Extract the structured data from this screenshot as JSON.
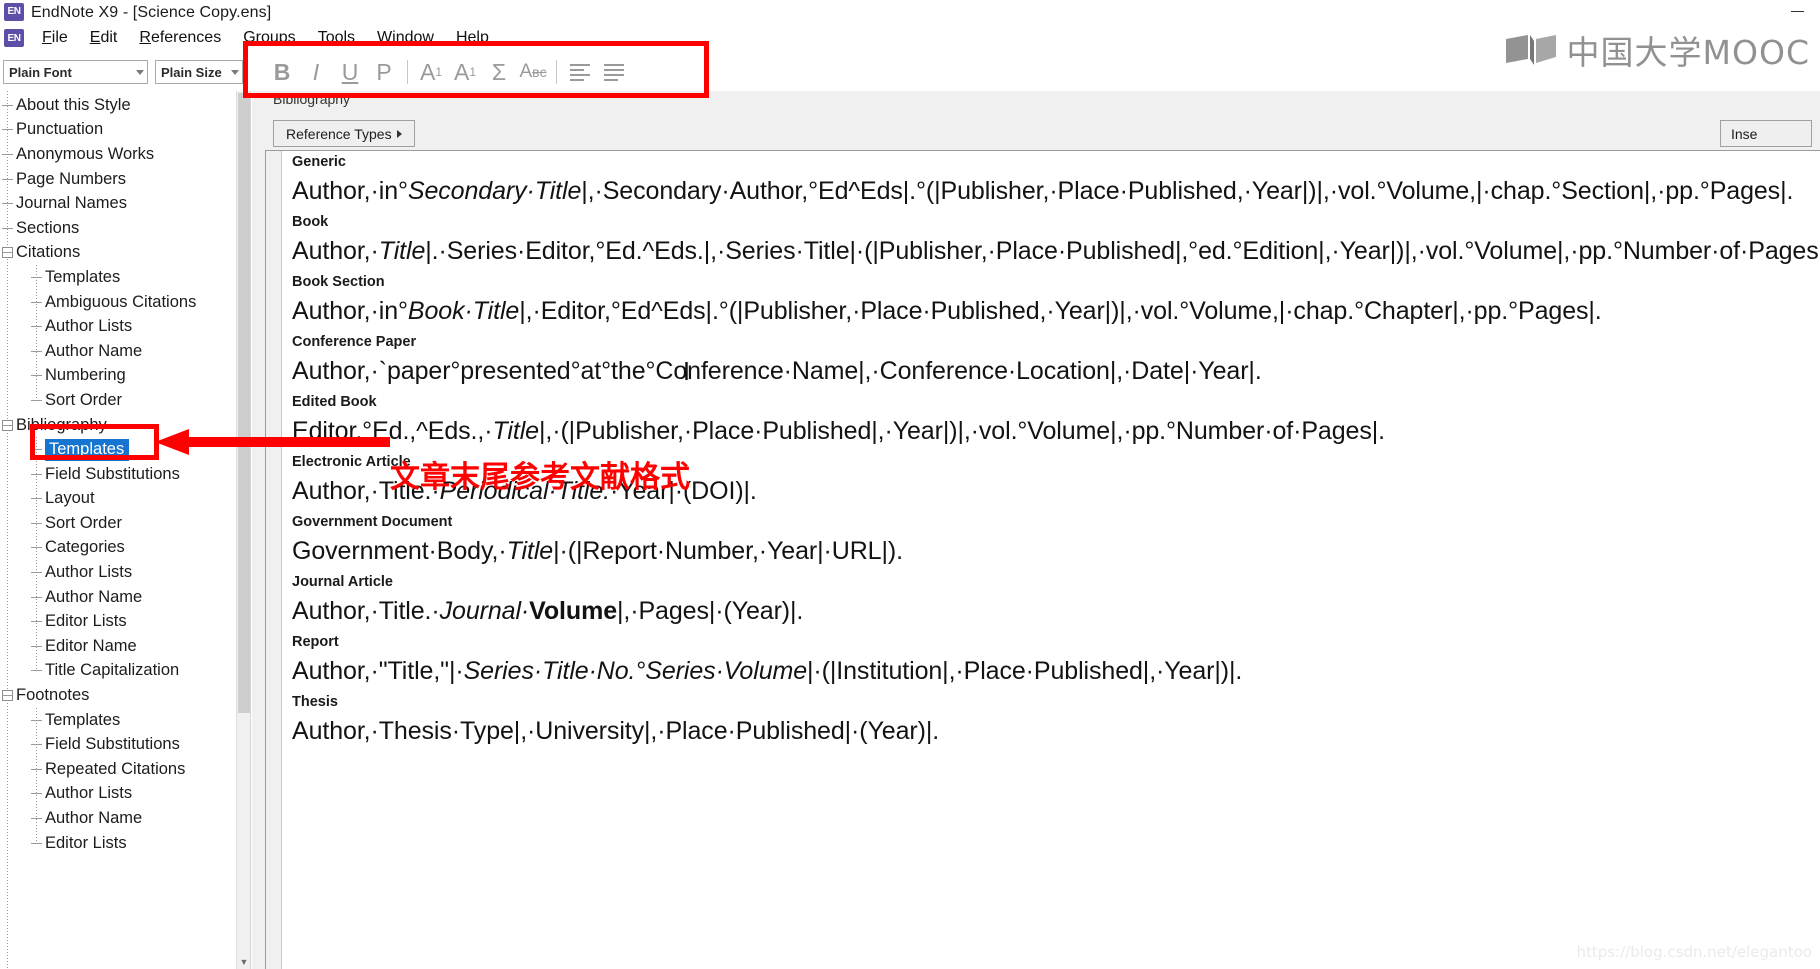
{
  "window": {
    "title": "EndNote X9 - [Science Copy.ens]",
    "app_icon": "endnote-icon",
    "minimize_label": "Minimize"
  },
  "menubar": {
    "app_icon": "endnote-icon",
    "items": [
      {
        "label": "File"
      },
      {
        "label": "Edit"
      },
      {
        "label": "References"
      },
      {
        "label": "Groups"
      },
      {
        "label": "Tools"
      },
      {
        "label": "Window"
      },
      {
        "label": "Help"
      }
    ]
  },
  "format_toolbar": {
    "font_combo": {
      "value": "Plain Font",
      "icon": "chevron-down-icon"
    },
    "size_combo": {
      "value": "Plain Size",
      "icon": "chevron-down-icon"
    },
    "buttons": [
      {
        "name": "bold-button",
        "glyph": "B"
      },
      {
        "name": "italic-button",
        "glyph": "I"
      },
      {
        "name": "underline-button",
        "glyph": "U"
      },
      {
        "name": "plain-button",
        "glyph": "P"
      },
      {
        "name": "superscript-button",
        "glyph": "A¹"
      },
      {
        "name": "subscript-button",
        "glyph": "A₁"
      },
      {
        "name": "symbol-button",
        "glyph": "Σ"
      },
      {
        "name": "strikethrough-button",
        "glyph": "Aʙс"
      },
      {
        "name": "align-left-button",
        "glyph": "≡"
      },
      {
        "name": "align-justify-button",
        "glyph": "≡"
      }
    ]
  },
  "brand_watermark": {
    "text": "中国大学MOOC",
    "icon": "open-book-icon"
  },
  "tree": {
    "items": [
      {
        "label": "About this Style",
        "level": 1,
        "expander": null,
        "selected": false
      },
      {
        "label": "Punctuation",
        "level": 1,
        "expander": null,
        "selected": false
      },
      {
        "label": "Anonymous Works",
        "level": 1,
        "expander": null,
        "selected": false
      },
      {
        "label": "Page Numbers",
        "level": 1,
        "expander": null,
        "selected": false
      },
      {
        "label": "Journal Names",
        "level": 1,
        "expander": null,
        "selected": false
      },
      {
        "label": "Sections",
        "level": 1,
        "expander": null,
        "selected": false
      },
      {
        "label": "Citations",
        "level": 1,
        "expander": "collapse",
        "selected": false
      },
      {
        "label": "Templates",
        "level": 2,
        "expander": null,
        "selected": false
      },
      {
        "label": "Ambiguous Citations",
        "level": 2,
        "expander": null,
        "selected": false
      },
      {
        "label": "Author Lists",
        "level": 2,
        "expander": null,
        "selected": false
      },
      {
        "label": "Author Name",
        "level": 2,
        "expander": null,
        "selected": false
      },
      {
        "label": "Numbering",
        "level": 2,
        "expander": null,
        "selected": false
      },
      {
        "label": "Sort Order",
        "level": 2,
        "expander": null,
        "selected": false
      },
      {
        "label": "Bibliography",
        "level": 1,
        "expander": "collapse",
        "selected": false
      },
      {
        "label": "Templates",
        "level": 2,
        "expander": null,
        "selected": true
      },
      {
        "label": "Field Substitutions",
        "level": 2,
        "expander": null,
        "selected": false
      },
      {
        "label": "Layout",
        "level": 2,
        "expander": null,
        "selected": false
      },
      {
        "label": "Sort Order",
        "level": 2,
        "expander": null,
        "selected": false
      },
      {
        "label": "Categories",
        "level": 2,
        "expander": null,
        "selected": false
      },
      {
        "label": "Author Lists",
        "level": 2,
        "expander": null,
        "selected": false
      },
      {
        "label": "Author Name",
        "level": 2,
        "expander": null,
        "selected": false
      },
      {
        "label": "Editor Lists",
        "level": 2,
        "expander": null,
        "selected": false
      },
      {
        "label": "Editor Name",
        "level": 2,
        "expander": null,
        "selected": false
      },
      {
        "label": "Title Capitalization",
        "level": 2,
        "expander": null,
        "selected": false
      },
      {
        "label": "Footnotes",
        "level": 1,
        "expander": "collapse",
        "selected": false
      },
      {
        "label": "Templates",
        "level": 2,
        "expander": null,
        "selected": false
      },
      {
        "label": "Field Substitutions",
        "level": 2,
        "expander": null,
        "selected": false
      },
      {
        "label": "Repeated Citations",
        "level": 2,
        "expander": null,
        "selected": false
      },
      {
        "label": "Author Lists",
        "level": 2,
        "expander": null,
        "selected": false
      },
      {
        "label": "Author Name",
        "level": 2,
        "expander": null,
        "selected": false
      },
      {
        "label": "Editor Lists",
        "level": 2,
        "expander": null,
        "selected": false
      }
    ],
    "scrollbar": {
      "up_arrow": "▲",
      "down_arrow": "▼"
    }
  },
  "editor": {
    "caption": "Bibliography",
    "reference_types_button": "Reference Types",
    "insert_field_button": "Inse",
    "templates": [
      {
        "name": "Generic",
        "segments": [
          {
            "t": "Author,·in°",
            "s": "n"
          },
          {
            "t": "Secondary·Title",
            "s": "i"
          },
          {
            "t": "|,·Secondary·Author,°Ed^Eds|.°(|Publisher,·Place·Published,·Year|)|,·vol.°Volume,|·chap.°Section|,·pp.°Pages|.",
            "s": "n"
          }
        ]
      },
      {
        "name": "Book",
        "segments": [
          {
            "t": "Author,·",
            "s": "n"
          },
          {
            "t": "Title",
            "s": "i"
          },
          {
            "t": "|.·Series·Editor,°Ed.^Eds.|,·Series·Title|·(|Publisher,·Place·Published|,°ed.°Edition|,·Year|)|,·vol.°Volume|,·pp.°Number·of·Pages|.",
            "s": "n"
          }
        ]
      },
      {
        "name": "Book Section",
        "segments": [
          {
            "t": "Author,·in°",
            "s": "n"
          },
          {
            "t": "Book·Title",
            "s": "i"
          },
          {
            "t": "|,·Editor,°Ed^Eds|.°(|Publisher,·Place·Published,·Year|)|,·vol.°Volume,|·chap.°Chapter|,·pp.°Pages|.",
            "s": "n"
          }
        ]
      },
      {
        "name": "Conference Paper",
        "segments": [
          {
            "t": "Author,·`paper°presented°at°the°Conference·Name|,·Conference·Location|,·Date|·Year|.",
            "s": "n"
          }
        ]
      },
      {
        "name": "Edited Book",
        "segments": [
          {
            "t": "Editor,°Ed.,^Eds.,·",
            "s": "n"
          },
          {
            "t": "Title",
            "s": "i"
          },
          {
            "t": "|,·(|Publisher,·Place·Published|,·Year|)|,·vol.°Volume|,·pp.°Number·of·Pages|.",
            "s": "n"
          }
        ]
      },
      {
        "name": "Electronic Article",
        "segments": [
          {
            "t": "Author,·Title.·",
            "s": "n"
          },
          {
            "t": "Periodical·Title.",
            "s": "i"
          },
          {
            "t": "·Year|·(DOI)|.",
            "s": "n"
          }
        ]
      },
      {
        "name": "Government Document",
        "segments": [
          {
            "t": "Government·Body,·",
            "s": "n"
          },
          {
            "t": "Title",
            "s": "i"
          },
          {
            "t": "|·(|Report·Number,·Year|·URL|).",
            "s": "n"
          }
        ]
      },
      {
        "name": "Journal Article",
        "segments": [
          {
            "t": "Author,·Title.·",
            "s": "n"
          },
          {
            "t": "Journal·",
            "s": "i"
          },
          {
            "t": "Volume",
            "s": "b"
          },
          {
            "t": "|,·Pages|·(Year)|.",
            "s": "n"
          }
        ]
      },
      {
        "name": "Report",
        "segments": [
          {
            "t": "Author,·\"Title,\"|·",
            "s": "n"
          },
          {
            "t": "Series·Title·No.°Series·Volume",
            "s": "i"
          },
          {
            "t": "|·(|Institution|,·Place·Published|,·Year|)|.",
            "s": "n"
          }
        ]
      },
      {
        "name": "Thesis",
        "segments": [
          {
            "t": "Author,·Thesis·Type|,·University|,·Place·Published|·(Year)|.",
            "s": "n"
          }
        ]
      }
    ]
  },
  "annotations": {
    "highlight_color": "#ff0000",
    "chinese_note": "文章末尾参考文献格式",
    "rect_toolbar_name": "format-toolbar-highlight",
    "rect_tree_name": "bibliography-templates-highlight",
    "arrow_name": "red-arrow-pointer"
  },
  "watermark": {
    "url": "https://blog.csdn.net/elegantoo"
  }
}
